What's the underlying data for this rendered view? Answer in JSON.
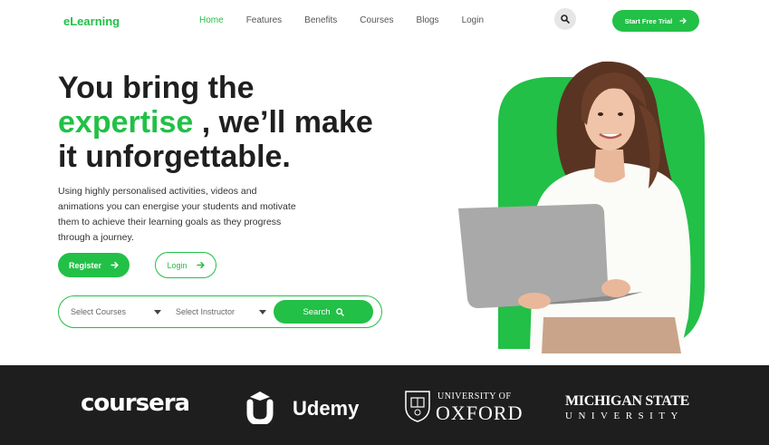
{
  "brand": {
    "logo": "eLearning",
    "accent": "#22c047"
  },
  "nav": {
    "items": [
      "Home",
      "Features",
      "Benefits",
      "Courses",
      "Blogs",
      "Login"
    ],
    "active": "Home"
  },
  "header": {
    "search_icon": "search-icon",
    "trial_label": "Start Free Trial"
  },
  "hero": {
    "headline_line1": "You bring the",
    "headline_accent": "expertise",
    "headline_line2_rest": " , we’ll make",
    "headline_line3": "it unforgettable.",
    "text": "Using highly personalised activities, videos and animations you can energise your students and motivate them to achieve their learning goals as they progress through a journey.",
    "register_label": "Register",
    "login_label": "Login"
  },
  "search": {
    "courses_select": "Select Courses",
    "instructor_select": "Select Instructor",
    "button_label": "Search"
  },
  "partners": {
    "coursera": "coursera",
    "udemy": "Udemy",
    "oxford_top": "UNIVERSITY OF",
    "oxford_main": "OXFORD",
    "msu_top": "MICHIGAN STATE",
    "msu_bottom": "UNIVERSITY"
  }
}
